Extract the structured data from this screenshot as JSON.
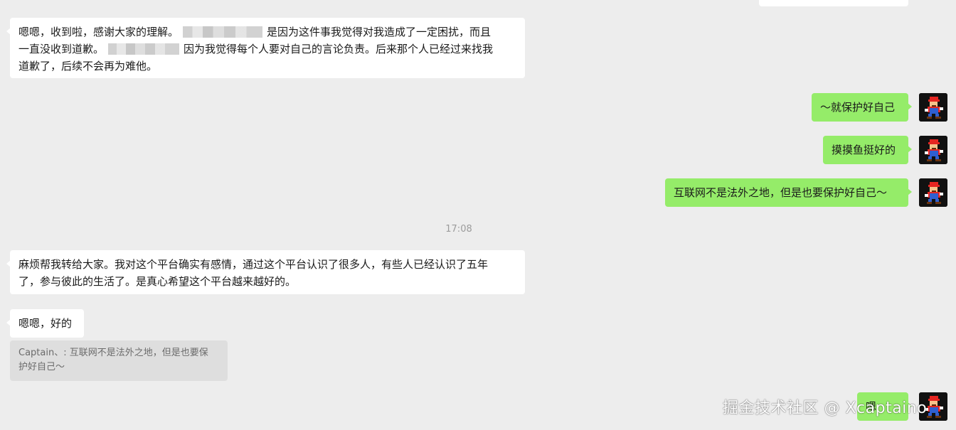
{
  "messages": {
    "m1": {
      "part1": "嗯嗯，收到啦，感谢大家的理解。",
      "part2": "是因为这件事我觉得对我造成了一定困扰，而且",
      "part3": "一直没收到道歉。",
      "part4": "因为我觉得每个人要对自己的言论负责。后来那个人已经过来找我",
      "part5": "道歉了，后续不会再为难他。"
    },
    "m2": "～就保护好自己",
    "m3": "摸摸鱼挺好的",
    "m4": "互联网不是法外之地，但是也要保护好自己～",
    "timestamp": "17:08",
    "m5": {
      "line1": "麻烦帮我转给大家。我对这个平台确实有感情，通过这个平台认识了很多人，有些人已经认识了五年",
      "line2": "了，参与彼此的生活了。是真心希望这个平台越来越好的。"
    },
    "m6": "嗯嗯，好的",
    "quote": {
      "line1": "Captain、: 互联网不是法外之地，但是也要保",
      "line2": "护好自己～"
    },
    "m7": "嗯"
  },
  "watermark": "掘金技术社区 @ Xcaptaino",
  "colors": {
    "background": "#ededed",
    "incoming_bubble": "#ffffff",
    "outgoing_bubble": "#95ec69",
    "quote_bg": "#dedede",
    "timestamp": "#9b9b9b"
  },
  "avatar_icon": "mario-avatar-icon"
}
